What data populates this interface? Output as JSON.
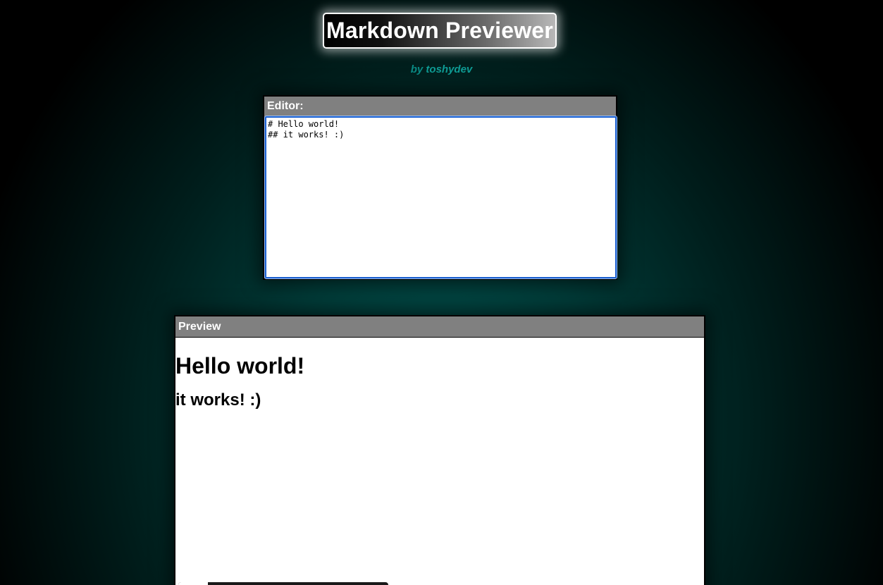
{
  "header": {
    "title": "Markdown Previewer",
    "by_prefix": "by ",
    "author": "toshydev"
  },
  "editor": {
    "label": "Editor:",
    "value": "# Hello world!\n## it works! :)"
  },
  "preview": {
    "label": "Preview",
    "h1": "Hello world!",
    "h2": "it works! :)"
  },
  "colors": {
    "background_center": "#00514d",
    "panel_header": "#808080",
    "byline": "#0a8a84",
    "focus_border": "#1a5fd0"
  }
}
